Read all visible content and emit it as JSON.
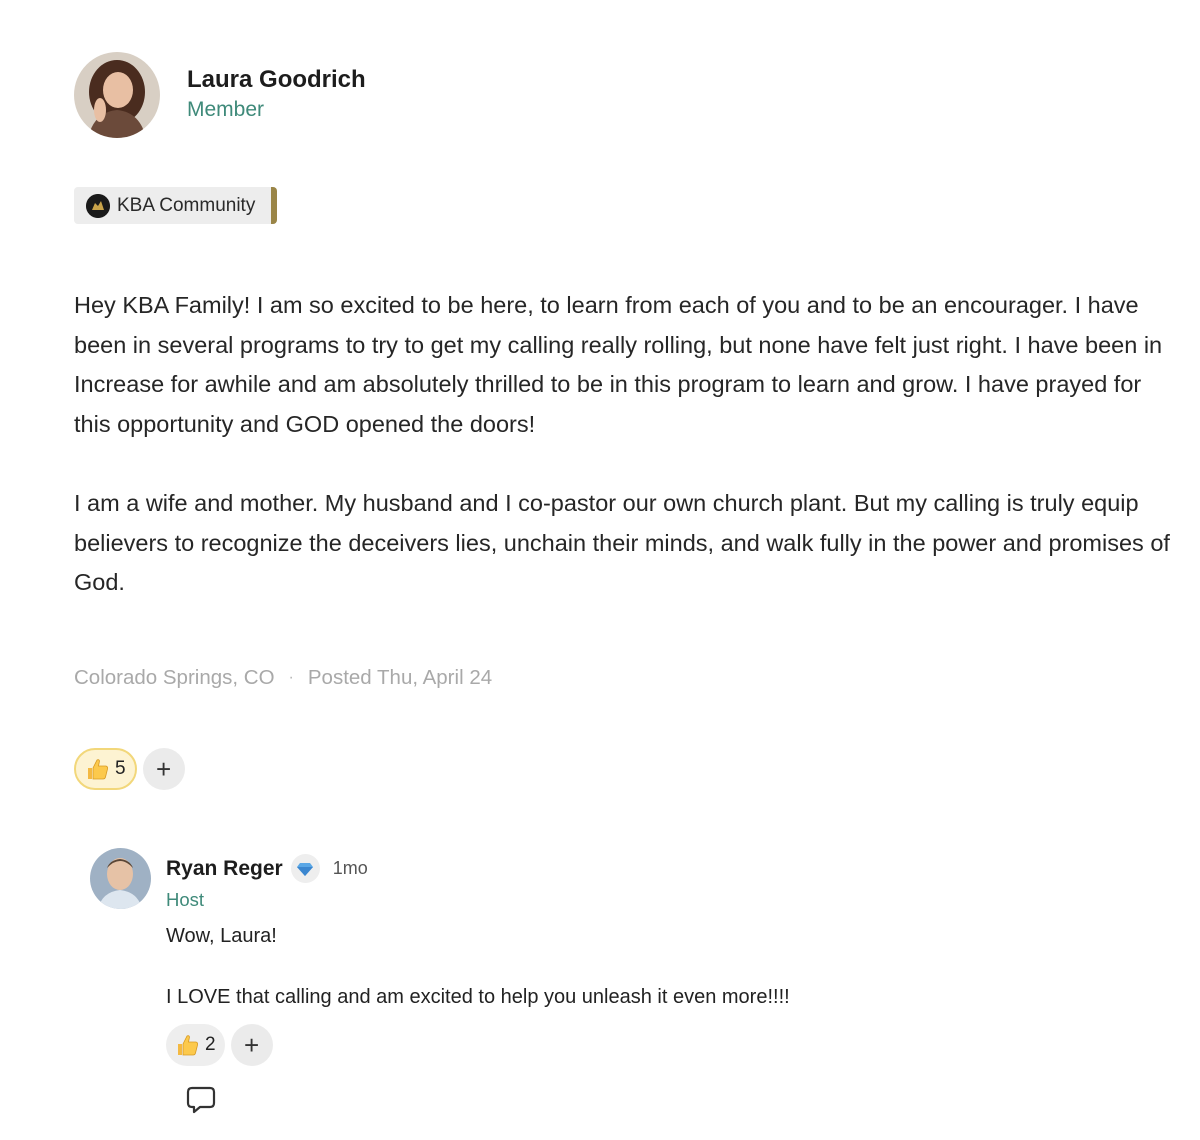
{
  "author": {
    "name": "Laura Goodrich",
    "role": "Member"
  },
  "space": {
    "name": "KBA Community",
    "accent_color": "#9a8547"
  },
  "post": {
    "paragraphs": [
      "Hey KBA Family! I am so excited to be here, to learn from each of you and to be an encourager. I have been in several programs to try to get my calling really rolling, but none have felt just right. I have been in Increase for awhile and am absolutely thrilled to be in this program to learn and grow. I have prayed for this opportunity and GOD opened the doors!",
      "I am a wife and mother. My husband and I co-pastor our own church plant. But my calling is truly equip believers to recognize the deceivers lies, unchain their minds, and walk fully in the power and promises of God."
    ],
    "location": "Colorado Springs, CO",
    "meta_separator": "·",
    "posted": "Posted Thu, April 24",
    "reactions": {
      "emoji_icon": "thumbs-up-icon",
      "count": "5",
      "add_label": "+"
    }
  },
  "comment": {
    "author": "Ryan Reger",
    "badge_icon": "diamond-icon",
    "time": "1mo",
    "role": "Host",
    "paragraphs": [
      "Wow, Laura!",
      "I LOVE that calling and am excited to help you unleash it even more!!!!"
    ],
    "reactions": {
      "emoji_icon": "thumbs-up-icon",
      "count": "2",
      "add_label": "+"
    },
    "reply_icon": "speech-bubble-icon"
  },
  "colors": {
    "role_text": "#3f8a7a",
    "meta_text": "#a9a9a9",
    "reaction_active_bg": "#fdf3d2",
    "reaction_active_border": "#f2d77a"
  }
}
